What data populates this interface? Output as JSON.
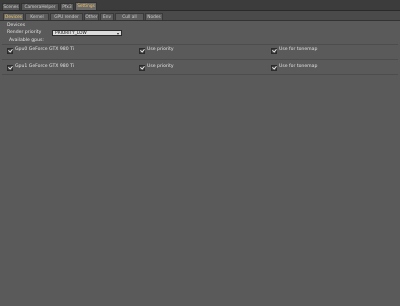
{
  "top_tabs": [
    "Scenes",
    "CameraHelper",
    "Pfx3",
    "Settings"
  ],
  "sub_tabs": [
    "Devices",
    "Kernel",
    "GPU render",
    "Other",
    "Env",
    "Cull all",
    "Nodes"
  ],
  "devices": {
    "group_label": "Devices",
    "render_priority_label": "Render priority",
    "render_priority_value": "PRIORITY_LOW",
    "available_gpus_label": "Available gpus:",
    "gpus": [
      {
        "name": "Gpu0 GeForce GTX 980 Ti",
        "use_priority": "Use priority",
        "use_for_imager": "Use for tonemap"
      },
      {
        "name": "Gpu1 GeForce GTX 980 Ti",
        "use_priority": "Use priority",
        "use_for_imager": "Use for tonemap"
      }
    ]
  }
}
